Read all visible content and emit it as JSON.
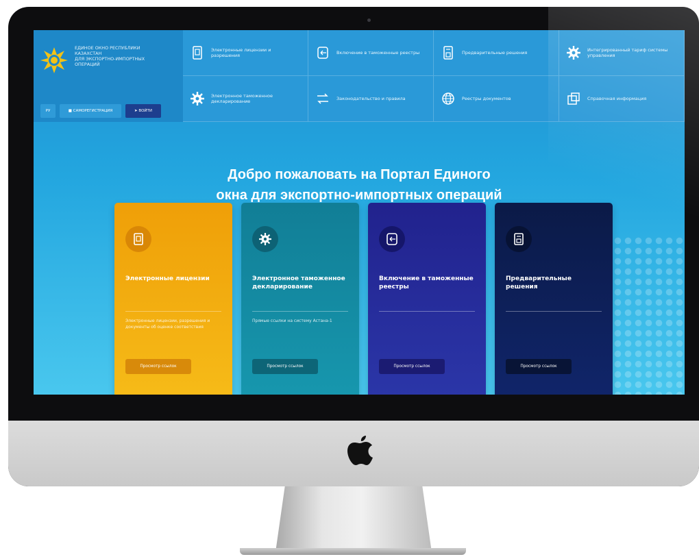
{
  "brand": {
    "lines": [
      "ЕДИНОЕ ОКНО РЕСПУБЛИКИ",
      "КАЗАХСТАН",
      "ДЛЯ ЭКСПОРТНО-ИМПОРТНЫХ",
      "ОПЕРАЦИЙ"
    ],
    "lang": "РУ",
    "register": "САМОРЕГИСТРАЦИЯ",
    "login": "ВОЙТИ"
  },
  "nav": [
    {
      "label": "Электронные лицензии и разрешения",
      "icon": "document-icon"
    },
    {
      "label": "Включение в таможенные реестры",
      "icon": "register-icon"
    },
    {
      "label": "Предварительные решения",
      "icon": "decision-icon"
    },
    {
      "label": "Интегрированный тариф системы управления",
      "icon": "gear-icon"
    },
    {
      "label": "Электронное таможенное декларирование",
      "icon": "gear-icon"
    },
    {
      "label": "Законодательство и правила",
      "icon": "law-icon"
    },
    {
      "label": "Реестры документов",
      "icon": "globe-icon"
    },
    {
      "label": "Справочная информация",
      "icon": "info-icon"
    }
  ],
  "hero": {
    "line1": "Добро пожаловать на Портал Единого",
    "line2": "окна для экспортно-импортных операций"
  },
  "cards": [
    {
      "title": "Электронные лицензии",
      "desc": "Электронные лицензии, разрешения и документы об оценке соответствия",
      "button": "Просмотр ссылок",
      "icon": "document-icon"
    },
    {
      "title": "Электронное таможенное декларирование",
      "desc": "Прямые ссылки на систему Астана-1",
      "button": "Просмотр ссылок",
      "icon": "gear-icon"
    },
    {
      "title": "Включение в таможенные реестры",
      "desc": "",
      "button": "Просмотр ссылок",
      "icon": "register-icon"
    },
    {
      "title": "Предварительные решения",
      "desc": "",
      "button": "Просмотр ссылок",
      "icon": "decision-icon"
    }
  ]
}
